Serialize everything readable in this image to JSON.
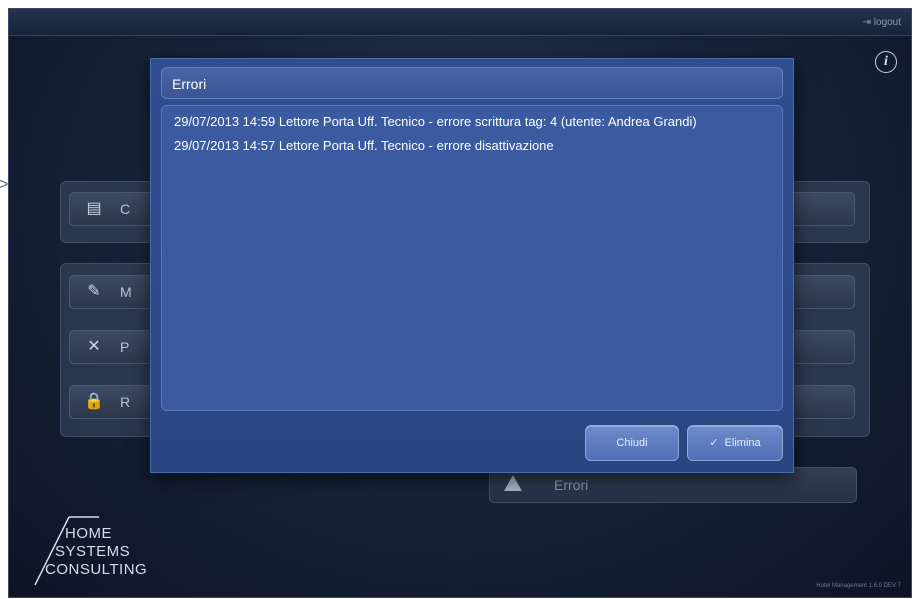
{
  "topbar": {
    "logout_label": "logout"
  },
  "background_menu": [
    {
      "icon": "bed-icon",
      "label": "C"
    },
    {
      "icon": "pencil-icon",
      "label": "M"
    },
    {
      "icon": "tools-icon",
      "label": "P"
    },
    {
      "icon": "lock-icon",
      "label": "R"
    }
  ],
  "errors_button": {
    "label": "Errori",
    "icon": "warning-icon"
  },
  "modal": {
    "title": "Errori",
    "errors": [
      "29/07/2013 14:59 Lettore Porta Uff. Tecnico - errore scrittura tag: 4 (utente: Andrea Grandi)",
      "29/07/2013 14:57 Lettore Porta Uff. Tecnico - errore disattivazione"
    ],
    "close_label": "Chiudi",
    "delete_label": "Elimina"
  },
  "logo": {
    "line1": "HOME",
    "line2": "SYSTEMS",
    "line3": "CONSULTING"
  },
  "footer": {
    "version": "Hotel Management 1.6.0 DEV 7"
  }
}
